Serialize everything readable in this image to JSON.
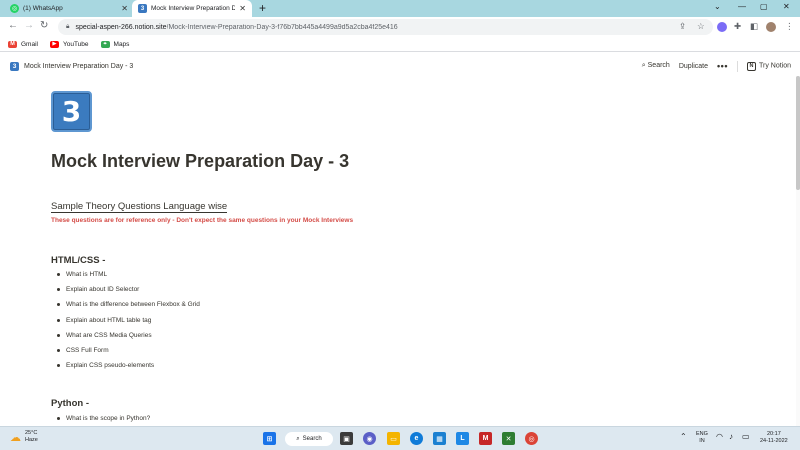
{
  "browser": {
    "tabs": [
      {
        "title": "(1) WhatsApp",
        "active": false
      },
      {
        "title": "Mock Interview Preparation Day",
        "active": true
      }
    ],
    "url_host": "special-aspen-266.notion.site",
    "url_path": "/Mock-Interview-Preparation-Day-3-f76b7bb445a4499a9d5a2cba4f25e416",
    "bookmarks": [
      {
        "label": "Gmail",
        "icon": "gmail-icon"
      },
      {
        "label": "YouTube",
        "icon": "youtube-icon"
      },
      {
        "label": "Maps",
        "icon": "maps-icon"
      }
    ]
  },
  "notion": {
    "breadcrumb": "Mock Interview Preparation Day - 3",
    "search_label": "Search",
    "duplicate_label": "Duplicate",
    "more_label": "•••",
    "try_label": "Try Notion"
  },
  "page": {
    "icon_text": "3",
    "title": "Mock Interview Preparation Day - 3",
    "subheading": "Sample Theory Questions Language wise",
    "note": "These questions are for reference only - Don't expect the same questions in your Mock Interviews",
    "sections": [
      {
        "heading": "HTML/CSS -",
        "items": [
          "What is HTML",
          "Explain about ID Selector",
          "What is the difference between Flexbox & Grid",
          "Explain about HTML table tag",
          "What are CSS Media Queries",
          "CSS Full Form",
          "Explain CSS pseudo-elements"
        ]
      },
      {
        "heading": "Python -",
        "items": [
          "What is the scope in Python?"
        ]
      }
    ]
  },
  "taskbar": {
    "weather_temp": "25°C",
    "weather_desc": "Haze",
    "search_label": "Search",
    "lang": "ENG",
    "region": "IN",
    "time": "20:17",
    "date": "24-11-2022"
  }
}
